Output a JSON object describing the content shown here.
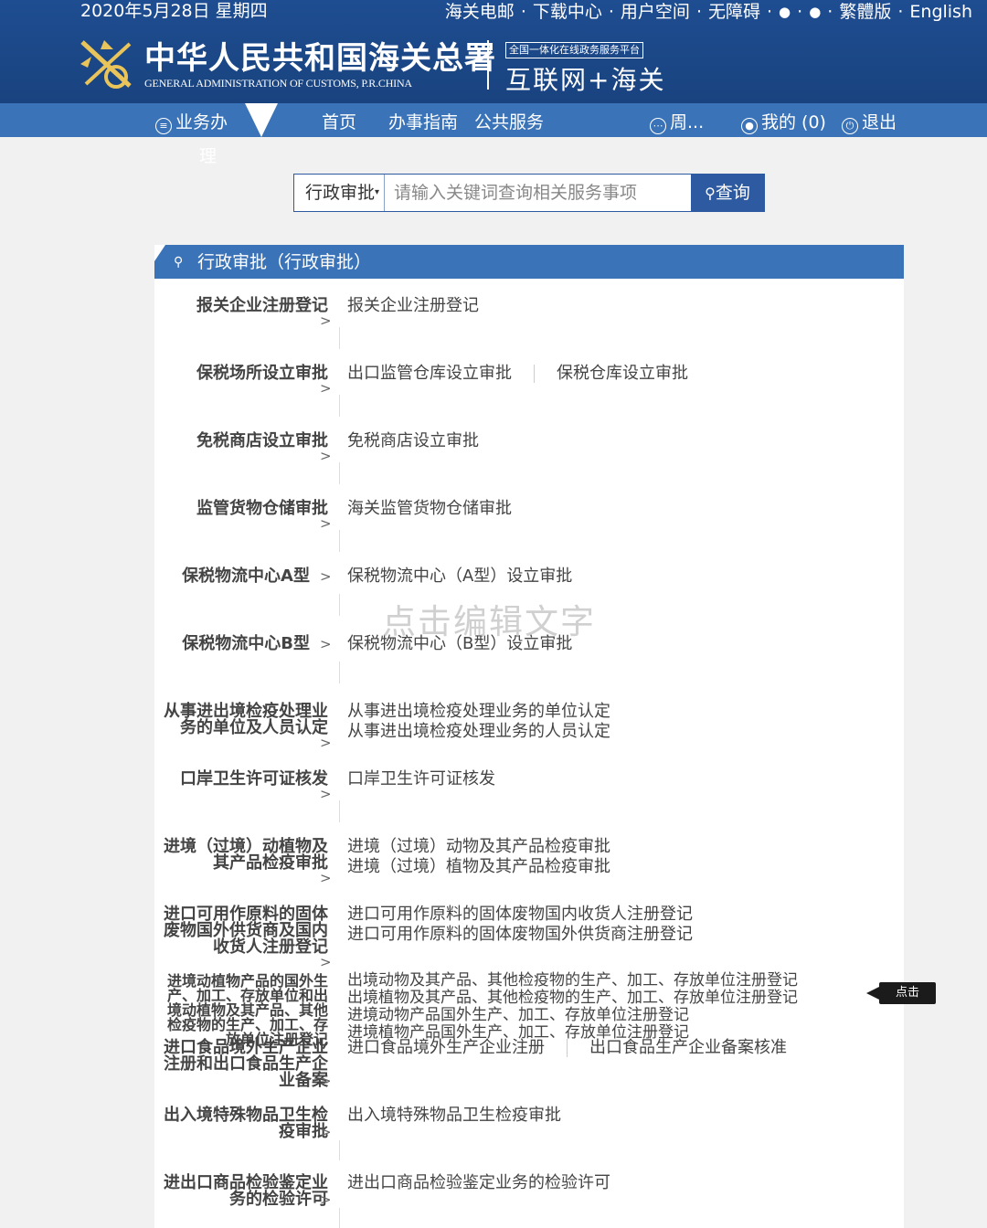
{
  "header": {
    "date": "2020年5月28日  星期四",
    "top_links": [
      "海关电邮",
      "下载中心",
      "用户空间",
      "无障碍",
      "微博",
      "微信",
      "繁體版",
      "English"
    ],
    "top_link_separator": "·",
    "logo_cn": "中华人民共和国海关总署",
    "logo_en": "GENERAL ADMINISTRATION OF CUSTOMS, P.R.CHINA",
    "platform_tag": "全国一体化在线政务服务平台",
    "platform_name": "互联网+海关"
  },
  "nav": {
    "business": "业务办",
    "business_extra": "理",
    "home": "首页",
    "guide": "办事指南",
    "public_service": "公共服务",
    "user": "周...",
    "mine": "我的 (0)",
    "logout": "退出"
  },
  "search": {
    "category": "行政审批",
    "placeholder": "请输入关键词查询相关服务事项",
    "value": "",
    "button": "查询"
  },
  "panel": {
    "title": "行政审批（行政审批）",
    "rows": [
      {
        "category": "报关企业注册登记",
        "items": [
          "报关企业注册登记"
        ]
      },
      {
        "category": "保税场所设立审批",
        "items": [
          "出口监管仓库设立审批",
          "保税仓库设立审批"
        ]
      },
      {
        "category": "免税商店设立审批",
        "items": [
          "免税商店设立审批"
        ]
      },
      {
        "category": "监管货物仓储审批",
        "items": [
          "海关监管货物仓储审批"
        ]
      },
      {
        "category": "保税物流中心A型",
        "items": [
          "保税物流中心（A型）设立审批"
        ]
      },
      {
        "category": "保税物流中心B型",
        "items": [
          "保税物流中心（B型）设立审批"
        ]
      },
      {
        "category": "从事进出境检疫处理业务的单位及人员认定",
        "items": [
          "从事进出境检疫处理业务的单位认定",
          "从事进出境检疫处理业务的人员认定"
        ]
      },
      {
        "category": "口岸卫生许可证核发",
        "items": [
          "口岸卫生许可证核发"
        ]
      },
      {
        "category": "进境（过境）动植物及其产品检疫审批",
        "items": [
          "进境（过境）动物及其产品检疫审批",
          "进境（过境）植物及其产品检疫审批"
        ]
      },
      {
        "category": "进口可用作原料的固体废物国外供货商及国内收货人注册登记",
        "items": [
          "进口可用作原料的固体废物国内收货人注册登记",
          "进口可用作原料的固体废物国外供货商注册登记"
        ]
      },
      {
        "category": "进境动植物产品的国外生产、加工、存放单位和出境动植物及其产品、其他检疫物的生产、加工、存放单位注册登记",
        "items": [
          "出境动物及其产品、其他检疫物的生产、加工、存放单位注册登记",
          "出境植物及其产品、其他检疫物的生产、加工、存放单位注册登记",
          "进境动物产品国外生产、加工、存放单位注册登记",
          "进境植物产品国外生产、加工、存放单位注册登记"
        ]
      },
      {
        "category": "进口食品境外生产企业注册和出口食品生产企业备案",
        "items": [
          "进口食品境外生产企业注册",
          "出口食品生产企业备案核准"
        ]
      },
      {
        "category": "出入境特殊物品卫生检疫审批",
        "items": [
          "出入境特殊物品卫生检疫审批"
        ]
      },
      {
        "category": "进出口商品检验鉴定业务的检验许可",
        "items": [
          "进出口商品检验鉴定业务的检验许可"
        ]
      }
    ]
  },
  "overlay": {
    "watermark": "点击编辑文字",
    "click_tip": "点击"
  },
  "colors": {
    "header_bg": "#1b4889",
    "nav_bg": "#3a73b8",
    "panel_head_bg": "#3a73b8",
    "page_bg": "#f1f1f1"
  }
}
